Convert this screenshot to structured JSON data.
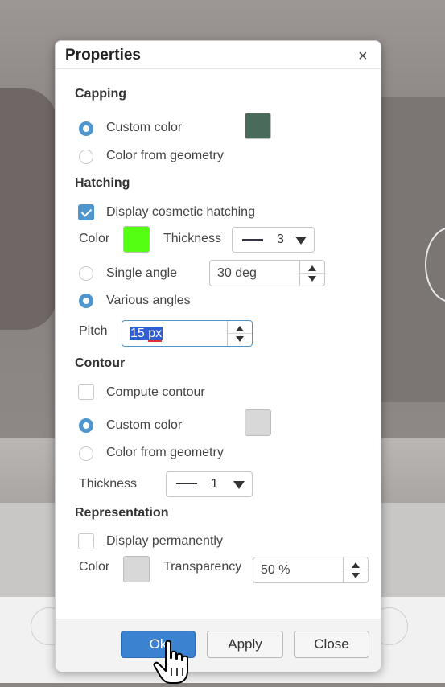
{
  "dialog": {
    "title": "Properties",
    "close_glyph": "×"
  },
  "capping": {
    "title": "Capping",
    "custom_color_label": "Custom color",
    "custom_color_checked": true,
    "custom_color_swatch": "#4a6a5c",
    "color_from_geometry_label": "Color from geometry"
  },
  "hatching": {
    "title": "Hatching",
    "display_cosmetic_label": "Display cosmetic hatching",
    "display_cosmetic_checked": true,
    "color_label": "Color",
    "color_swatch": "#55ff11",
    "thickness_label": "Thickness",
    "thickness_value": "3",
    "single_angle_label": "Single angle",
    "single_angle_value": "30 deg",
    "various_angles_label": "Various angles",
    "various_angles_checked": true,
    "pitch_label": "Pitch",
    "pitch_number": "15",
    "pitch_unit": "px"
  },
  "contour": {
    "title": "Contour",
    "compute_label": "Compute contour",
    "custom_color_label": "Custom color",
    "custom_color_swatch": "#d8d8d8",
    "color_from_geometry_label": "Color from geometry",
    "thickness_label": "Thickness",
    "thickness_value": "1"
  },
  "representation": {
    "title": "Representation",
    "display_permanently_label": "Display permanently",
    "color_label": "Color",
    "color_swatch": "#d8d8d8",
    "transparency_label": "Transparency",
    "transparency_value": "50 %"
  },
  "footer": {
    "ok_label": "Ok",
    "apply_label": "Apply",
    "close_label": "Close"
  },
  "colors": {
    "accent": "#4f96cf",
    "primary_button": "#3b82d0"
  }
}
